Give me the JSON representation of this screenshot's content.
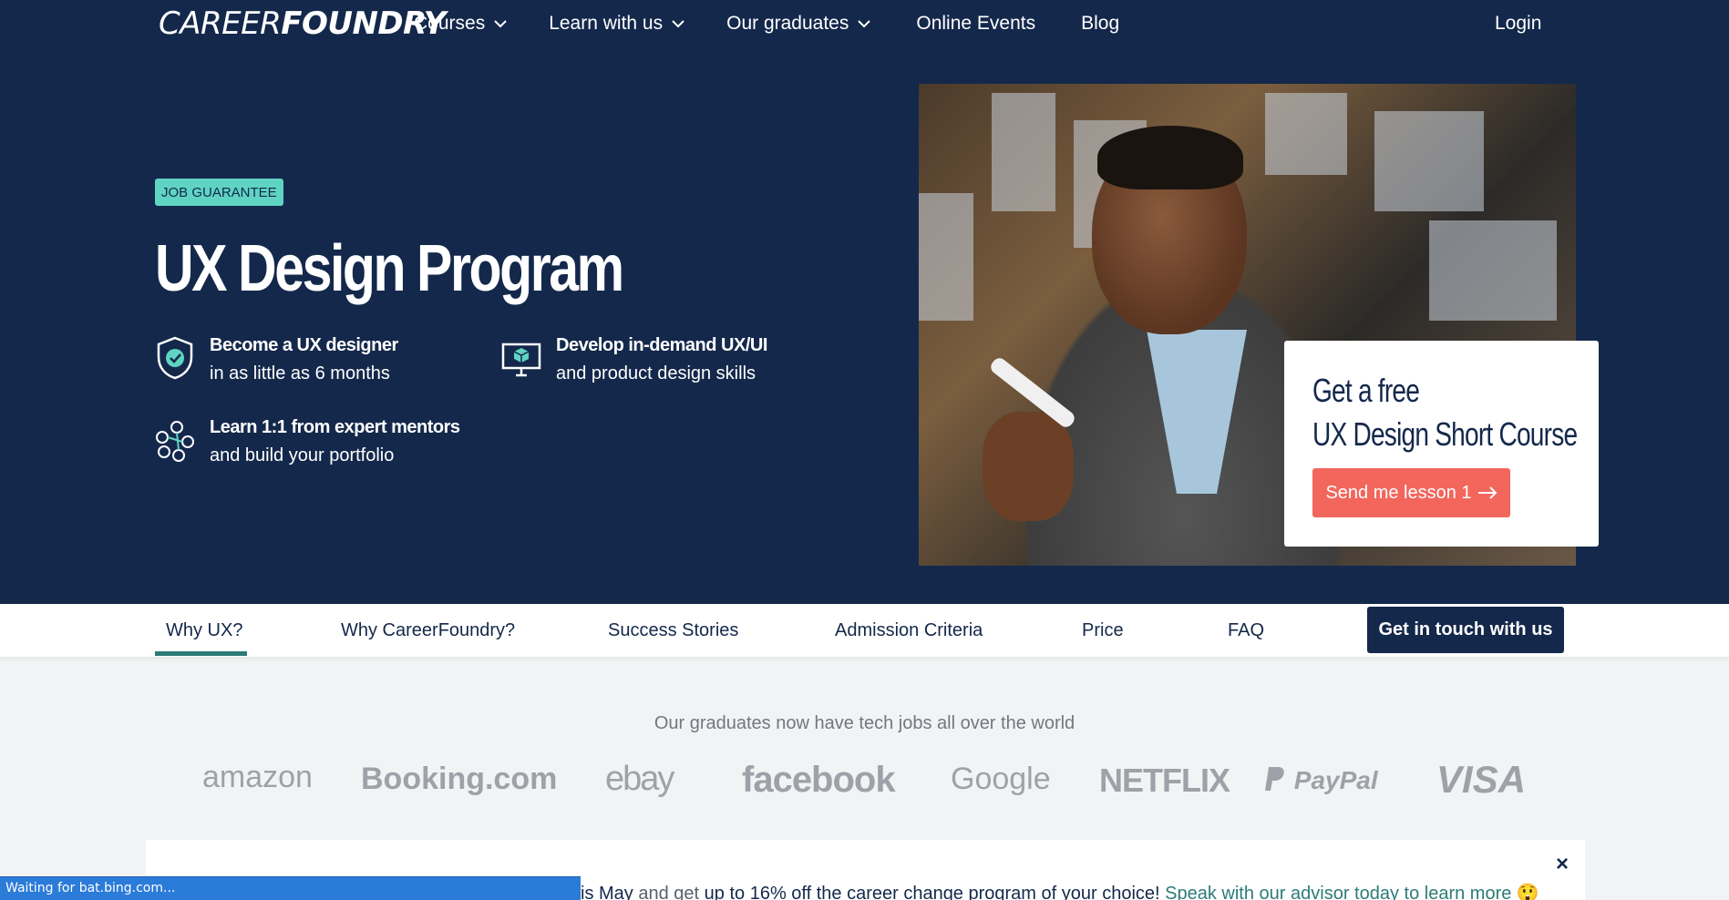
{
  "header": {
    "logo_part1": "CAREER",
    "logo_part2": "FOUNDRY",
    "nav": [
      {
        "label": "Courses",
        "dropdown": true
      },
      {
        "label": "Learn with us",
        "dropdown": true
      },
      {
        "label": "Our graduates",
        "dropdown": true
      },
      {
        "label": "Online Events",
        "dropdown": false
      },
      {
        "label": "Blog",
        "dropdown": false
      }
    ],
    "login": "Login"
  },
  "hero": {
    "badge": "JOB GUARANTEE",
    "title": "UX Design Program",
    "features": [
      {
        "icon": "shield-check-icon",
        "line1": "Become a UX designer",
        "line2": "in as little as 6 months"
      },
      {
        "icon": "monitor-cube-icon",
        "line1": "Develop in-demand UX/UI",
        "line2": "and product design skills"
      },
      {
        "icon": "mentors-network-icon",
        "line1": "Learn 1:1 from expert mentors",
        "line2": "and build your portfolio"
      }
    ],
    "cta": {
      "line1": "Get a free",
      "line2": "UX Design Short Course",
      "button": "Send me lesson 1"
    }
  },
  "subnav": {
    "tabs": [
      "Why UX?",
      "Why CareerFoundry?",
      "Success Stories",
      "Admission Criteria",
      "Price",
      "FAQ"
    ],
    "active": "Why UX?",
    "contact_button": "Get in touch with us"
  },
  "graduates": {
    "text": "Our graduates now have tech jobs all over the world",
    "logos": [
      "amazon",
      "Booking.com",
      "ebay",
      "facebook",
      "Google",
      "NETFLIX",
      "PayPal",
      "VISA"
    ]
  },
  "banner": {
    "part1": "is May",
    "part2": "and get",
    "part3": "up to 16% off the career change program of your choice!",
    "link": "Speak with our advisor today to learn more",
    "close": "×"
  },
  "statusbar": "Waiting for bat.bing.com...",
  "colors": {
    "navy": "#14284b",
    "teal": "#5fd4c2",
    "coral": "#f2665c",
    "tab_accent": "#2d7b78"
  }
}
